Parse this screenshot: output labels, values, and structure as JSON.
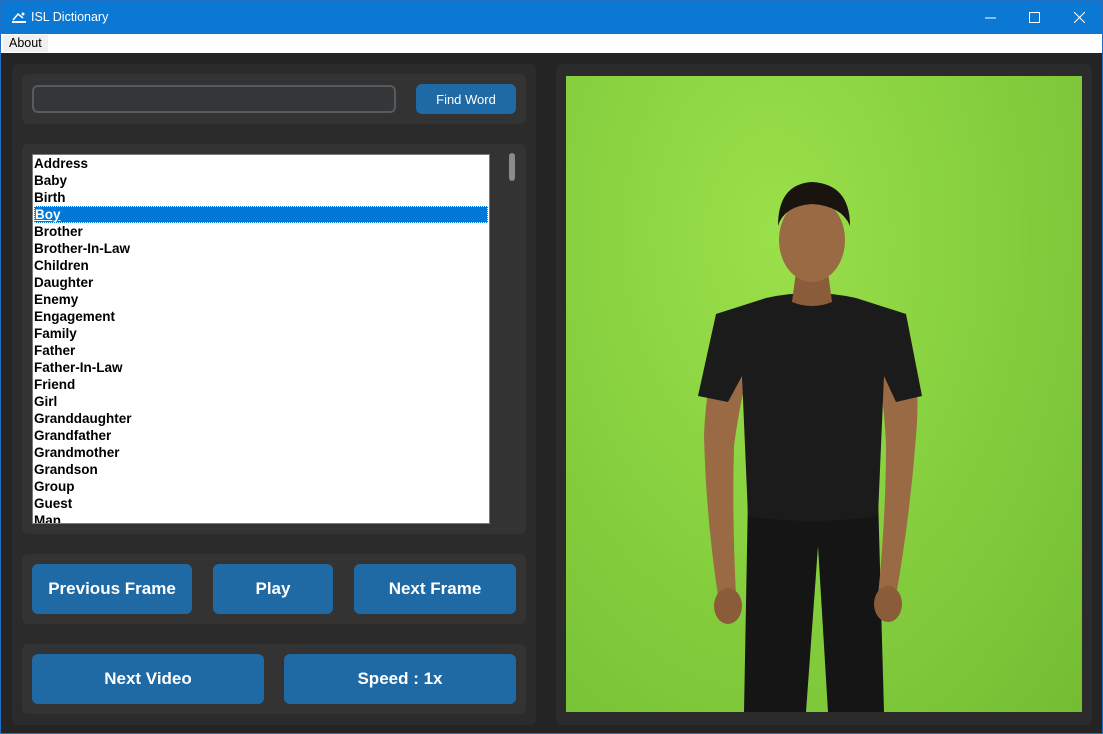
{
  "window": {
    "title": "ISL Dictionary",
    "controls": {
      "minimize": "—",
      "maximize": "☐",
      "close": "✕"
    }
  },
  "menu": {
    "about": "About"
  },
  "search": {
    "value": "",
    "placeholder": "",
    "button_label": "Find Word"
  },
  "word_list": {
    "items": [
      "Address",
      "Baby",
      "Birth",
      "Boy",
      "Brother",
      "Brother-In-Law",
      "Children",
      "Daughter",
      "Enemy",
      "Engagement",
      "Family",
      "Father",
      "Father-In-Law",
      "Friend",
      "Girl",
      "Granddaughter",
      "Grandfather",
      "Grandmother",
      "Grandson",
      "Group",
      "Guest",
      "Man"
    ],
    "selected": "Boy"
  },
  "controls": {
    "previous_frame": "Previous Frame",
    "play": "Play",
    "next_frame": "Next Frame",
    "next_video": "Next Video",
    "speed": "Speed : 1x"
  },
  "video": {
    "background": "green-screen",
    "subject": "person-standing"
  },
  "colors": {
    "accent": "#1f6aa5",
    "titlebar": "#0b78d4",
    "panel": "#2b2b2b",
    "card": "#333333",
    "selection": "#0078d7"
  }
}
